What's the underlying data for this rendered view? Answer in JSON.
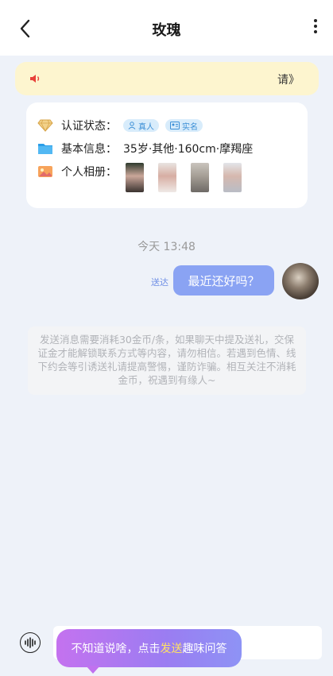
{
  "header": {
    "title": "玫瑰"
  },
  "notice": {
    "ticker_text": "请》"
  },
  "profile": {
    "auth_label": "认证状态：",
    "badges": {
      "real_person": "真人",
      "real_name": "实名"
    },
    "basic_label": "基本信息：",
    "basic_value": "35岁·其他·160cm·摩羯座",
    "album_label": "个人相册："
  },
  "chat": {
    "time": "今天 13:48",
    "sent_label": "送达",
    "message": "最近还好吗？"
  },
  "system_notice": "发送消息需要消耗30金币/条，如果聊天中提及送礼，交保证金才能解锁联系方式等内容，请勿相信。若遇到色情、线下约会等引诱送礼请提高警惕，谨防诈骗。相互关注不消耗金币，祝遇到有缘人~",
  "tip": {
    "prefix": "不知道说啥，点击",
    "highlight": "发送",
    "suffix": "趣味问答"
  },
  "colors": {
    "accent": "#8aa3f3",
    "notice_bg": "#fdf5cf",
    "badge_text": "#3c8fd6",
    "tip_highlight": "#ffe066"
  }
}
